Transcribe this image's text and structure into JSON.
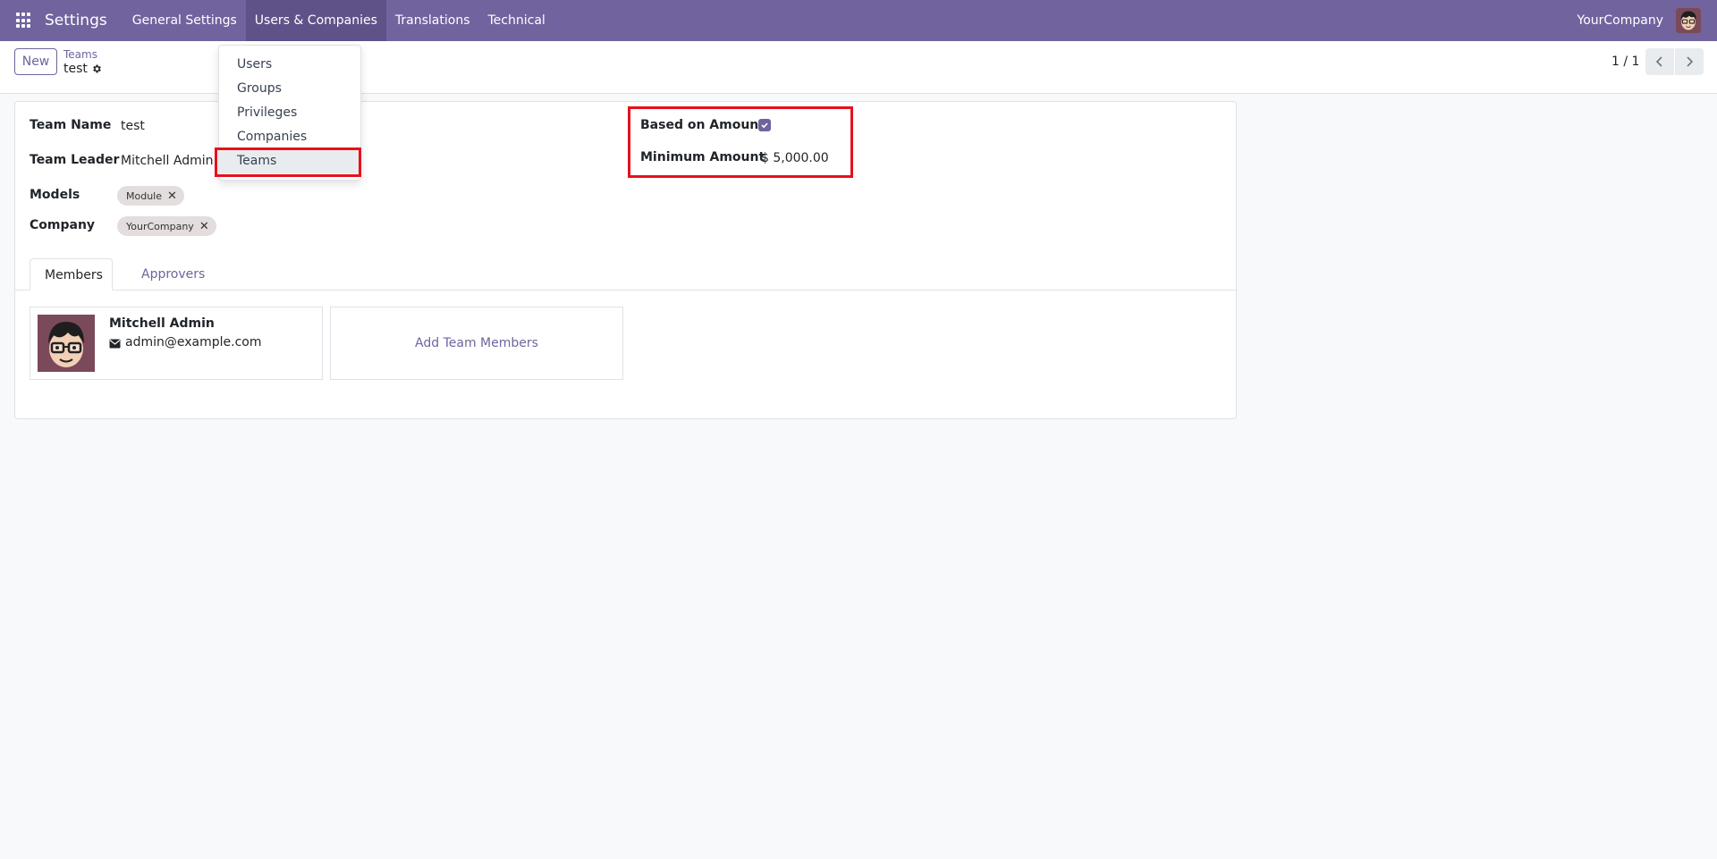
{
  "topbar": {
    "app_title": "Settings",
    "menu": [
      "General Settings",
      "Users & Companies",
      "Translations",
      "Technical"
    ],
    "company": "YourCompany"
  },
  "control": {
    "new_label": "New",
    "breadcrumb_parent": "Teams",
    "record_name": "test",
    "pager_value": "1 / 1"
  },
  "dropdown": {
    "items": [
      "Users",
      "Groups",
      "Privileges",
      "Companies",
      "Teams"
    ],
    "selected": "Teams"
  },
  "form": {
    "team_name_label": "Team Name",
    "team_name_value": "test",
    "team_leader_label": "Team Leader",
    "team_leader_value": "Mitchell Admin",
    "models_label": "Models",
    "models_tags": [
      "Module"
    ],
    "company_label": "Company",
    "company_tags": [
      "YourCompany"
    ],
    "based_on_amount_label": "Based on Amount",
    "based_on_amount_checked": true,
    "minimum_amount_label": "Minimum Amount",
    "minimum_amount_value": "$ 5,000.00"
  },
  "tabs": [
    "Members",
    "Approvers"
  ],
  "members": [
    {
      "name": "Mitchell Admin",
      "email": "admin@example.com"
    }
  ],
  "add_members_label": "Add Team Members",
  "colors": {
    "brand": "#71639e",
    "highlight": "#e8101c"
  }
}
